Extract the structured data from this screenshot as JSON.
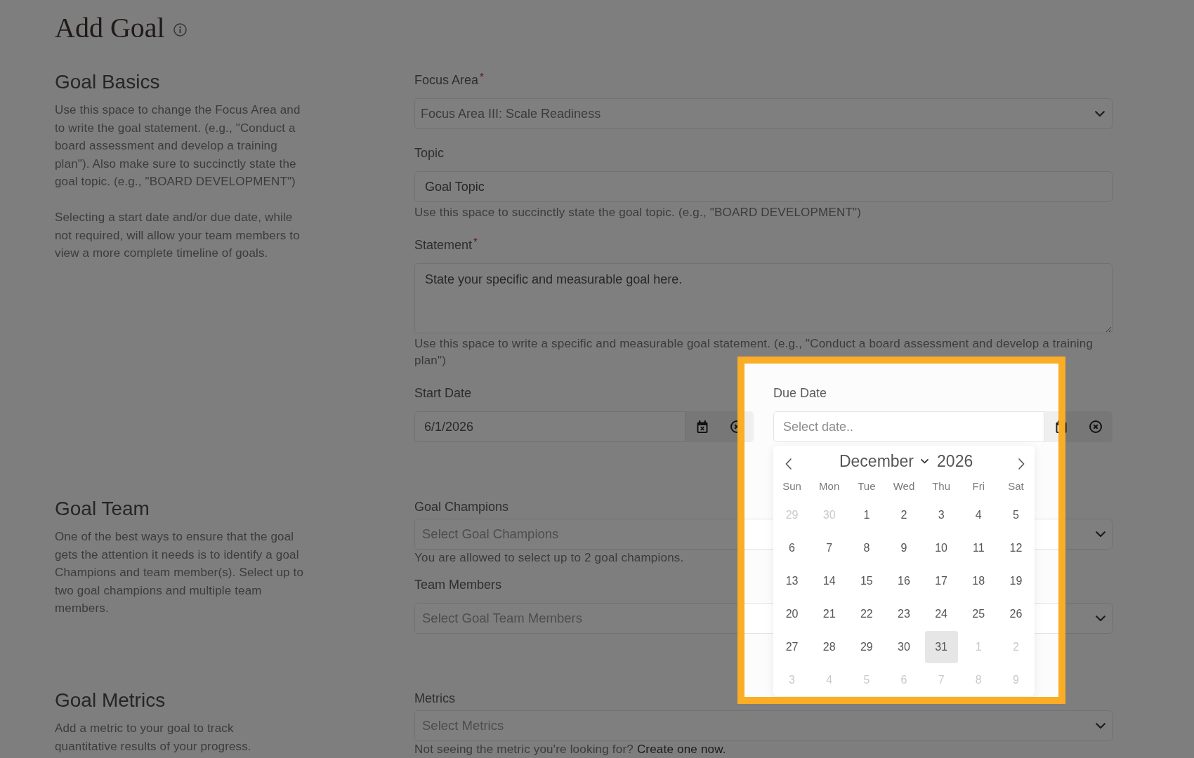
{
  "page": {
    "title": "Add Goal"
  },
  "sections": [
    {
      "heading": "Goal Basics",
      "description": [
        "Use this space to change the Focus Area and to write the goal statement. (e.g., \"Conduct a board assessment and develop a training plan\"). Also make sure to succinctly state the goal topic. (e.g., \"BOARD DEVELOPMENT\")",
        "Selecting a start date and/or due date, while not required, will allow your team members to view a more complete timeline of goals."
      ],
      "fields": [
        {
          "kind": "select",
          "label": "Focus Area",
          "required_mark": "*",
          "value": "Focus Area III: Scale Readiness"
        },
        {
          "kind": "text",
          "label": "Topic",
          "placeholder": "Goal Topic",
          "help": "Use this space to succinctly state the goal topic. (e.g., \"BOARD DEVELOPMENT\")"
        },
        {
          "kind": "textarea",
          "label": "Statement",
          "required_mark": "*",
          "placeholder": "State your specific and measurable goal here.",
          "help": "Use this space to write a specific and measurable goal statement. (e.g., \"Conduct a board assessment and develop a training plan\")"
        },
        {
          "kind": "dates",
          "dates": [
            {
              "label": "Start Date",
              "value": "6/1/2026"
            },
            {
              "label": "Due Date",
              "placeholder": "Select date..",
              "highlighted": true,
              "calendar": {
                "month": "December",
                "year": "2026",
                "weekdays": [
                  "Sun",
                  "Mon",
                  "Tue",
                  "Wed",
                  "Thu",
                  "Fri",
                  "Sat"
                ],
                "days": [
                  {
                    "label": "29",
                    "outside": true,
                    "selected": false
                  },
                  {
                    "label": "30",
                    "outside": true,
                    "selected": false
                  },
                  {
                    "label": "1",
                    "outside": false,
                    "selected": false
                  },
                  {
                    "label": "2",
                    "outside": false,
                    "selected": false
                  },
                  {
                    "label": "3",
                    "outside": false,
                    "selected": false
                  },
                  {
                    "label": "4",
                    "outside": false,
                    "selected": false
                  },
                  {
                    "label": "5",
                    "outside": false,
                    "selected": false
                  },
                  {
                    "label": "6",
                    "outside": false,
                    "selected": false
                  },
                  {
                    "label": "7",
                    "outside": false,
                    "selected": false
                  },
                  {
                    "label": "8",
                    "outside": false,
                    "selected": false
                  },
                  {
                    "label": "9",
                    "outside": false,
                    "selected": false
                  },
                  {
                    "label": "10",
                    "outside": false,
                    "selected": false
                  },
                  {
                    "label": "11",
                    "outside": false,
                    "selected": false
                  },
                  {
                    "label": "12",
                    "outside": false,
                    "selected": false
                  },
                  {
                    "label": "13",
                    "outside": false,
                    "selected": false
                  },
                  {
                    "label": "14",
                    "outside": false,
                    "selected": false
                  },
                  {
                    "label": "15",
                    "outside": false,
                    "selected": false
                  },
                  {
                    "label": "16",
                    "outside": false,
                    "selected": false
                  },
                  {
                    "label": "17",
                    "outside": false,
                    "selected": false
                  },
                  {
                    "label": "18",
                    "outside": false,
                    "selected": false
                  },
                  {
                    "label": "19",
                    "outside": false,
                    "selected": false
                  },
                  {
                    "label": "20",
                    "outside": false,
                    "selected": false
                  },
                  {
                    "label": "21",
                    "outside": false,
                    "selected": false
                  },
                  {
                    "label": "22",
                    "outside": false,
                    "selected": false
                  },
                  {
                    "label": "23",
                    "outside": false,
                    "selected": false
                  },
                  {
                    "label": "24",
                    "outside": false,
                    "selected": false
                  },
                  {
                    "label": "25",
                    "outside": false,
                    "selected": false
                  },
                  {
                    "label": "26",
                    "outside": false,
                    "selected": false
                  },
                  {
                    "label": "27",
                    "outside": false,
                    "selected": false
                  },
                  {
                    "label": "28",
                    "outside": false,
                    "selected": false
                  },
                  {
                    "label": "29",
                    "outside": false,
                    "selected": false
                  },
                  {
                    "label": "30",
                    "outside": false,
                    "selected": false
                  },
                  {
                    "label": "31",
                    "outside": false,
                    "selected": true
                  },
                  {
                    "label": "1",
                    "outside": true,
                    "selected": false
                  },
                  {
                    "label": "2",
                    "outside": true,
                    "selected": false
                  },
                  {
                    "label": "3",
                    "outside": true,
                    "selected": false
                  },
                  {
                    "label": "4",
                    "outside": true,
                    "selected": false
                  },
                  {
                    "label": "5",
                    "outside": true,
                    "selected": false
                  },
                  {
                    "label": "6",
                    "outside": true,
                    "selected": false
                  },
                  {
                    "label": "7",
                    "outside": true,
                    "selected": false
                  },
                  {
                    "label": "8",
                    "outside": true,
                    "selected": false
                  },
                  {
                    "label": "9",
                    "outside": true,
                    "selected": false
                  }
                ]
              }
            }
          ]
        }
      ]
    },
    {
      "heading": "Goal Team",
      "description": [
        "One of the best ways to ensure that the goal gets the attention it needs is to identify a goal Champions and team member(s). Select up to two goal champions and multiple team members."
      ],
      "fields": [
        {
          "kind": "multiselect",
          "label": "Goal Champions",
          "placeholder": "Select Goal Champions",
          "help": "You are allowed to select up to 2 goal champions."
        },
        {
          "kind": "multiselect",
          "label": "Team Members",
          "placeholder": "Select Goal Team Members"
        }
      ]
    },
    {
      "heading": "Goal Metrics",
      "description": [
        "Add a metric to your goal to track\nquantitative results of your progress."
      ],
      "fields": [
        {
          "kind": "multiselect",
          "label": "Metrics",
          "placeholder": "Select Metrics",
          "help": "Not seeing the metric you're looking for?",
          "help_link": "Create one now."
        }
      ]
    }
  ]
}
